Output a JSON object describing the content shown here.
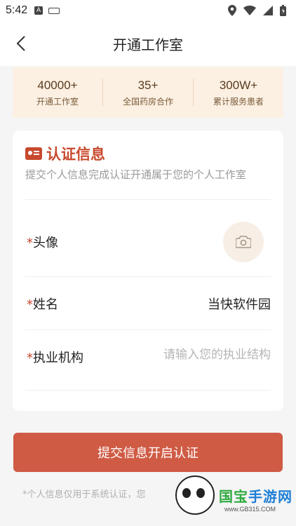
{
  "status_bar": {
    "time": "5:42",
    "left_icons": [
      "app-a-icon",
      "keyboard-icon"
    ],
    "right_icons": [
      "location-icon",
      "wifi-icon",
      "signal-icon",
      "battery-icon"
    ]
  },
  "nav": {
    "title": "开通工作室",
    "back_icon": "chevron-left-icon"
  },
  "stats": [
    {
      "value": "40000+",
      "label": "开通工作室"
    },
    {
      "value": "35+",
      "label": "全国药房合作"
    },
    {
      "value": "300W+",
      "label": "累计服务患者"
    }
  ],
  "card": {
    "title": "认证信息",
    "subtitle": "提交个人信息完成认证开通属于您的个人工作室",
    "avatar": {
      "required": "*",
      "label": "头像",
      "icon": "camera-icon"
    },
    "name": {
      "required": "*",
      "label": "姓名",
      "value": "当快软件园"
    },
    "org": {
      "required": "*",
      "label": "执业机构",
      "placeholder": "请输入您的执业结构"
    }
  },
  "submit": {
    "label": "提交信息开启认证"
  },
  "note": "*个人信息仅用于系统认证，您",
  "watermark": {
    "brand_1": "国宝",
    "brand_2": "手游网",
    "site": "www.GB315.COM"
  },
  "colors": {
    "accent": "#cf5b45",
    "title_red": "#c8492e",
    "stats_bg": "#fbf0e2"
  }
}
